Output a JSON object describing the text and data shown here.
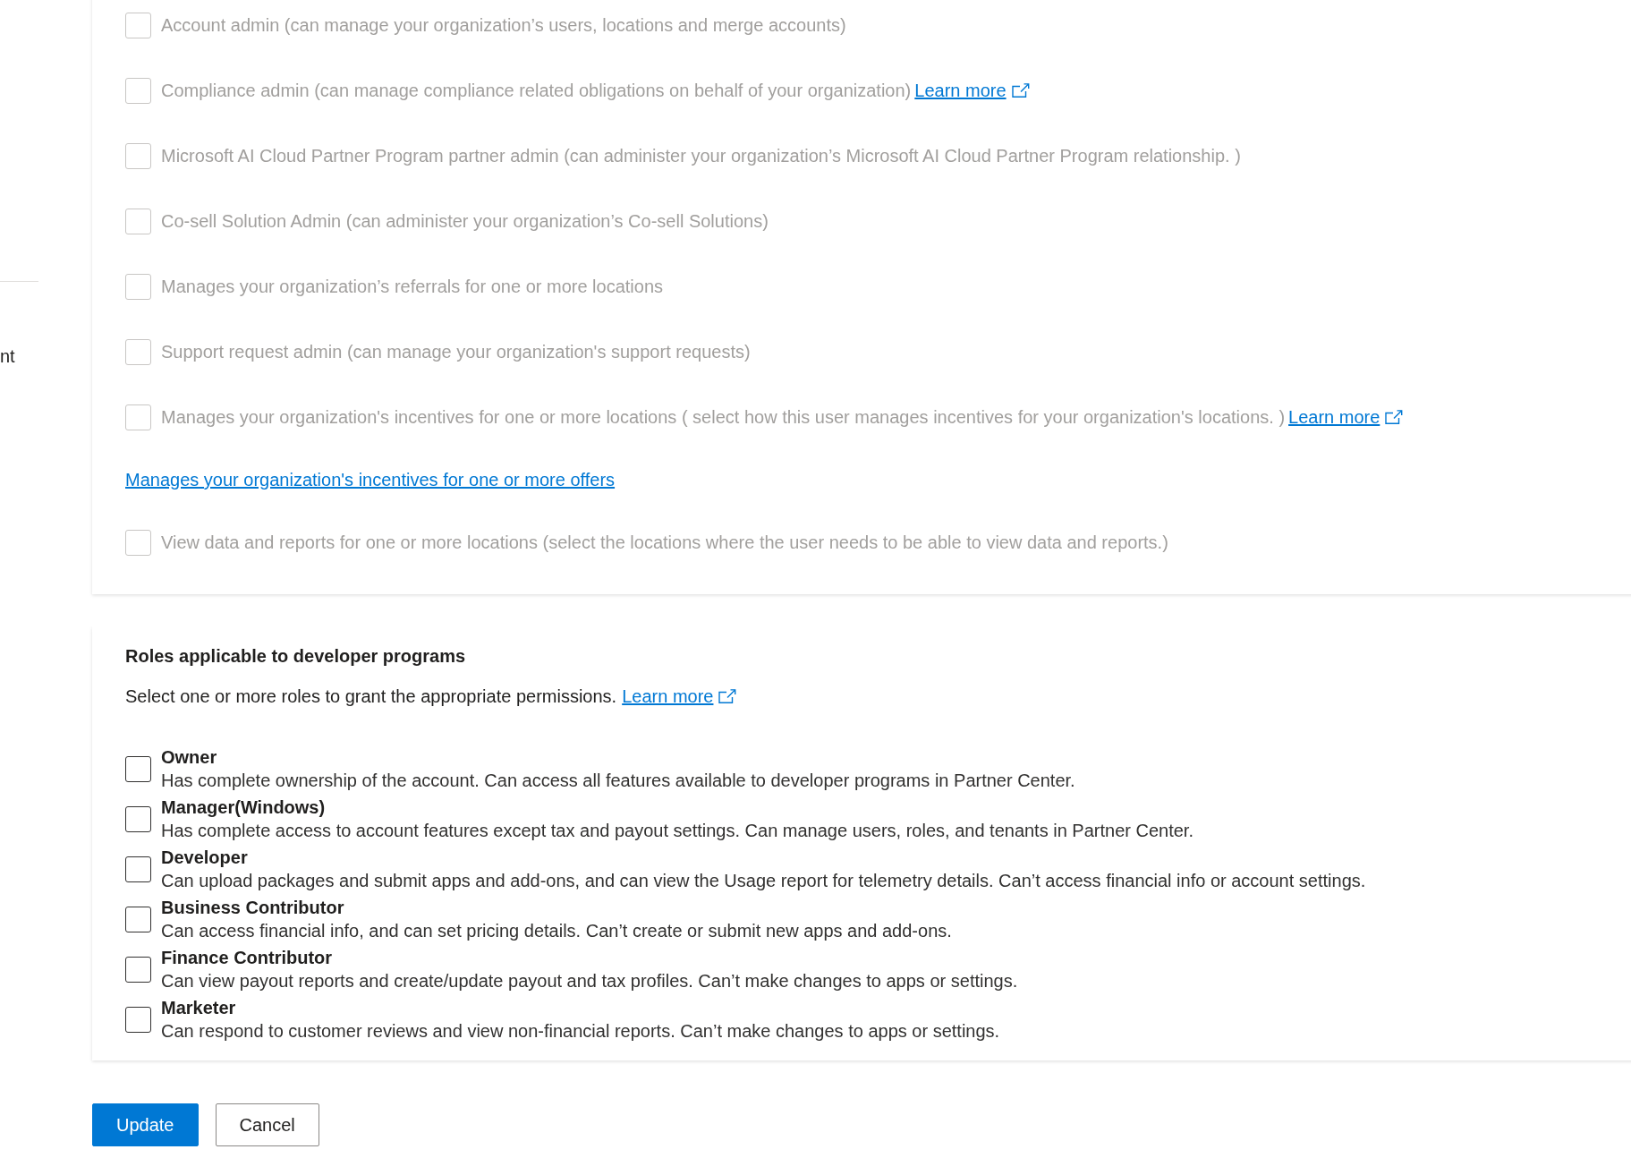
{
  "sidebar": {
    "items": [
      {
        "label": "nt"
      }
    ]
  },
  "org_roles": {
    "items": [
      {
        "kind": "checkbox",
        "label": "Account admin (can manage your organization’s users, locations and merge accounts)",
        "checked": false,
        "disabled": true
      },
      {
        "kind": "checkbox",
        "label": "Compliance admin (can manage compliance related obligations on behalf of your organization)",
        "link": "Learn more",
        "checked": false,
        "disabled": true
      },
      {
        "kind": "checkbox",
        "label": "Microsoft AI Cloud Partner Program partner admin (can administer your organization’s Microsoft AI Cloud Partner Program relationship. )",
        "checked": false,
        "disabled": true
      },
      {
        "kind": "checkbox",
        "label": "Co-sell Solution Admin (can administer your organization’s Co-sell Solutions)",
        "checked": false,
        "disabled": true
      },
      {
        "kind": "checkbox",
        "label": "Manages your organization’s referrals for one or more locations",
        "checked": false,
        "disabled": true
      },
      {
        "kind": "checkbox",
        "label": "Support request admin (can manage your organization's support requests)",
        "checked": false,
        "disabled": true
      },
      {
        "kind": "checkbox",
        "label": "Manages your organization's incentives for one or more locations ( select how this user manages incentives for your organization's locations. )",
        "link": "Learn more",
        "checked": false,
        "disabled": true
      },
      {
        "kind": "link",
        "label": "Manages your organization's incentives for one or more offers"
      },
      {
        "kind": "checkbox",
        "label": "View data and reports for one or more locations (select the locations where the user needs to be able to view data and reports.)",
        "checked": false,
        "disabled": true
      }
    ]
  },
  "developer_roles": {
    "title": "Roles applicable to developer programs",
    "description": "Select one or more roles to grant the appropriate permissions.",
    "link": "Learn more",
    "roles": [
      {
        "name": "Owner",
        "description": "Has complete ownership of the account. Can access all features available to developer programs in Partner Center.",
        "checked": false,
        "disabled": false
      },
      {
        "name": "Manager(Windows)",
        "description": "Has complete access to account features except tax and payout settings. Can manage users, roles, and tenants in Partner Center.",
        "checked": false,
        "disabled": false
      },
      {
        "name": "Developer",
        "description": "Can upload packages and submit apps and add-ons, and can view the Usage report for telemetry details. Can’t access financial info or account settings.",
        "checked": false,
        "disabled": false
      },
      {
        "name": "Business Contributor",
        "description": "Can access financial info, and can set pricing details. Can’t create or submit new apps and add-ons.",
        "checked": false,
        "disabled": false
      },
      {
        "name": "Finance Contributor",
        "description": "Can view payout reports and create/update payout and tax profiles. Can’t make changes to apps or settings.",
        "checked": false,
        "disabled": false
      },
      {
        "name": "Marketer",
        "description": "Can respond to customer reviews and view non-financial reports. Can’t make changes to apps or settings.",
        "checked": false,
        "disabled": false
      }
    ]
  },
  "buttons": [
    {
      "label": "Update",
      "kind": "primary"
    },
    {
      "label": "Cancel",
      "kind": "secondary"
    }
  ]
}
